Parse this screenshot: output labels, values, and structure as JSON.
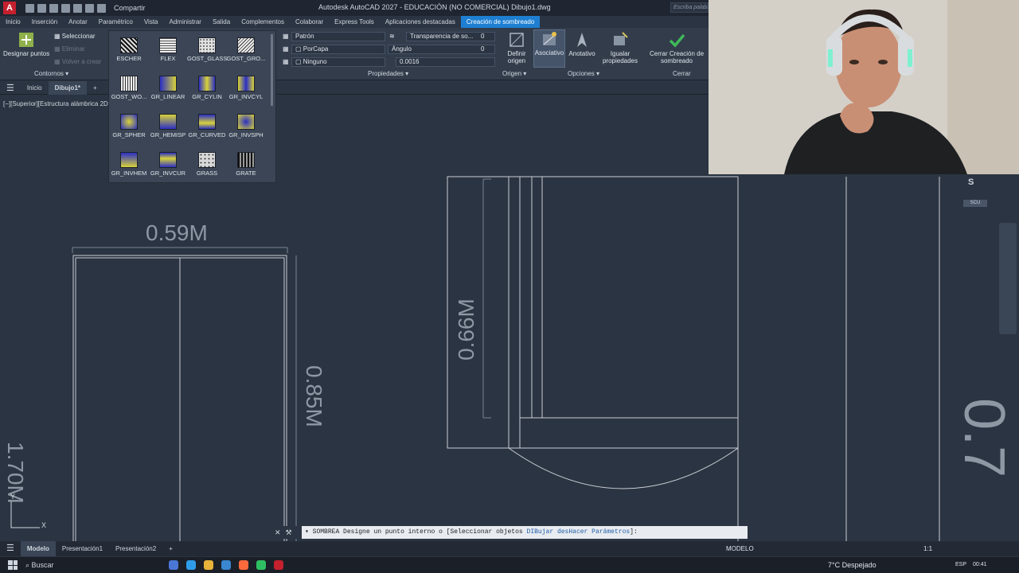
{
  "titlebar": {
    "share": "Compartir",
    "title": "Autodesk AutoCAD 2027 - EDUCACIÓN (NO COMERCIAL)    Dibujo1.dwg",
    "search_placeholder": "Escriba palabra"
  },
  "ribbon_tabs": [
    {
      "label": "Inicio"
    },
    {
      "label": "Inserción"
    },
    {
      "label": "Anotar"
    },
    {
      "label": "Paramétrico"
    },
    {
      "label": "Vista"
    },
    {
      "label": "Administrar"
    },
    {
      "label": "Salida"
    },
    {
      "label": "Complementos"
    },
    {
      "label": "Colaborar"
    },
    {
      "label": "Express Tools"
    },
    {
      "label": "Aplicaciones destacadas"
    },
    {
      "label": "Creación de sombreado",
      "active": true
    }
  ],
  "ribbon": {
    "designar_puntos": "Designar puntos",
    "seleccionar": "Seleccionar",
    "eliminar": "Eliminar",
    "volver_a_crear": "Volver a crear",
    "contornos": "Contornos",
    "patron": "Patrón",
    "porcapa": "PorCapa",
    "ninguno": "Ninguno",
    "transparencia": "Transparencia de so...",
    "transparencia_val": "0",
    "angulo": "Ángulo",
    "angulo_val": "0",
    "escala_val": "0.0016",
    "propiedades": "Propiedades",
    "definir_origen": "Definir origen",
    "origen": "Origen",
    "asociativo": "Asociativo",
    "anotativo": "Anotativo",
    "igualar_propiedades": "Igualar propiedades",
    "opciones": "Opciones",
    "cerrar_creacion": "Cerrar Creación de sombreado",
    "cerrar": "Cerrar"
  },
  "patterns": [
    {
      "label": "ESCHER"
    },
    {
      "label": "FLEX"
    },
    {
      "label": "GOST_GLASS"
    },
    {
      "label": "GOST_GRO..."
    },
    {
      "label": "GOST_WO..."
    },
    {
      "label": "GR_LINEAR"
    },
    {
      "label": "GR_CYLIN"
    },
    {
      "label": "GR_INVCYL"
    },
    {
      "label": "GR_SPHER"
    },
    {
      "label": "GR_HEMISP"
    },
    {
      "label": "GR_CURVED"
    },
    {
      "label": "GR_INVSPH"
    },
    {
      "label": "GR_INVHEM"
    },
    {
      "label": "GR_INVCUR"
    },
    {
      "label": "GRASS"
    },
    {
      "label": "GRATE"
    }
  ],
  "doc_tabs": [
    {
      "label": "Inicio"
    },
    {
      "label": "Dibujo1*",
      "active": true
    }
  ],
  "viewport_label": "[−][Superior][Estructura alámbrica 2D]",
  "drawing": {
    "dim_top": "0.59M",
    "dim_left": "1.70M",
    "dim_mid": "0.85M",
    "dim_right_vertical": "0.66M",
    "partial_right": "0.7"
  },
  "nav": {
    "compass_s": "S",
    "scu": "SCU"
  },
  "command_line": {
    "prefix": "SOMBREA",
    "text": " Designe un punto interno o [",
    "opt1": "Seleccionar objetos",
    "opt2": "DIBujar",
    "opt3": "desHacer",
    "opt4": "Parámetros",
    "suffix": "]:"
  },
  "layout_tabs": [
    {
      "label": "Modelo",
      "active": true
    },
    {
      "label": "Presentación1"
    },
    {
      "label": "Presentación2"
    }
  ],
  "status": {
    "modelo": "MODELO",
    "scale": "1:1"
  },
  "taskbar": {
    "search": "Buscar",
    "weather": "7°C  Despejado",
    "lang": "ESP",
    "time": "00:41"
  },
  "colors": {
    "accent": "#1e7fd2",
    "canvas": "#2b3442",
    "gradient_blue": "#2b2fc4",
    "gradient_yellow": "#d8d23a"
  }
}
